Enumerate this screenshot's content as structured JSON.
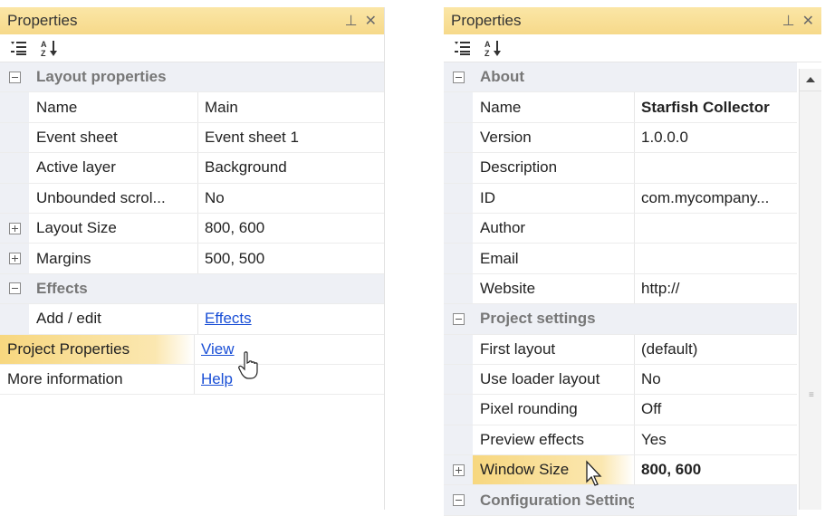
{
  "left_panel": {
    "title": "Properties",
    "pin_glyph": "⊥",
    "close_glyph": "✕",
    "rows": [
      {
        "kind": "category",
        "name": "Layout properties",
        "expander": "minus"
      },
      {
        "kind": "prop",
        "name": "Name",
        "value": "Main"
      },
      {
        "kind": "prop",
        "name": "Event sheet",
        "value": "Event sheet 1"
      },
      {
        "kind": "prop",
        "name": "Active layer",
        "value": "Background"
      },
      {
        "kind": "prop",
        "name": "Unbounded scrol...",
        "value": "No"
      },
      {
        "kind": "prop",
        "name": "Layout Size",
        "value": "800, 600",
        "expander": "plus"
      },
      {
        "kind": "prop",
        "name": "Margins",
        "value": "500, 500",
        "expander": "plus"
      },
      {
        "kind": "category",
        "name": "Effects",
        "expander": "minus"
      },
      {
        "kind": "prop",
        "name": "Add / edit",
        "value": "Effects",
        "link": true
      },
      {
        "kind": "wide",
        "name": "Project Properties",
        "value": "View",
        "link": true,
        "highlight": true
      },
      {
        "kind": "wide",
        "name": "More information",
        "value": "Help",
        "link": true
      }
    ]
  },
  "right_panel": {
    "title": "Properties",
    "pin_glyph": "⊥",
    "close_glyph": "✕",
    "rows": [
      {
        "kind": "category",
        "name": "About",
        "expander": "minus"
      },
      {
        "kind": "prop",
        "name": "Name",
        "value": "Starfish Collector",
        "bold": true
      },
      {
        "kind": "prop",
        "name": "Version",
        "value": "1.0.0.0"
      },
      {
        "kind": "prop",
        "name": "Description",
        "value": ""
      },
      {
        "kind": "prop",
        "name": "ID",
        "value": "com.mycompany..."
      },
      {
        "kind": "prop",
        "name": "Author",
        "value": ""
      },
      {
        "kind": "prop",
        "name": "Email",
        "value": ""
      },
      {
        "kind": "prop",
        "name": "Website",
        "value": "http://"
      },
      {
        "kind": "category",
        "name": "Project settings",
        "expander": "minus"
      },
      {
        "kind": "prop",
        "name": "First layout",
        "value": "(default)"
      },
      {
        "kind": "prop",
        "name": "Use loader layout",
        "value": "No"
      },
      {
        "kind": "prop",
        "name": "Pixel rounding",
        "value": "Off"
      },
      {
        "kind": "prop",
        "name": "Preview effects",
        "value": "Yes"
      },
      {
        "kind": "prop",
        "name": "Window Size",
        "value": "800, 600",
        "expander": "plus",
        "bold": true,
        "highlight": true
      },
      {
        "kind": "category",
        "name": "Configuration Settings",
        "expander": "minus"
      }
    ]
  },
  "icons": {
    "categorized": "categorized-view-icon",
    "alphabetical": "sort-alphabetical-icon",
    "pin": "pin-icon",
    "close": "close-icon",
    "cursor": "hand-pointer-icon"
  }
}
